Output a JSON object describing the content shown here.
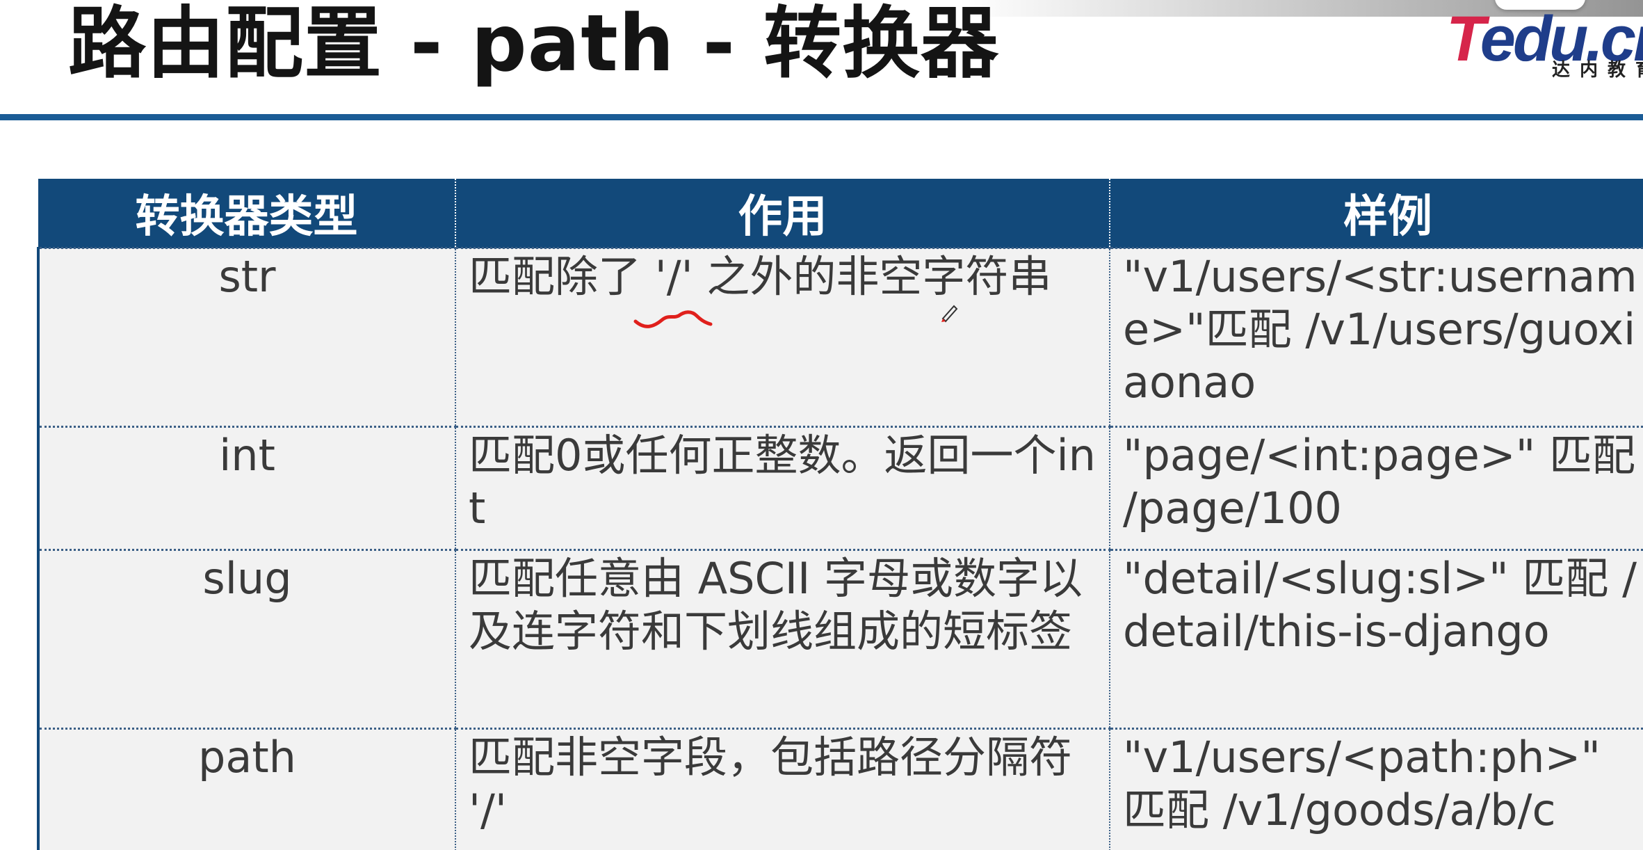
{
  "slide": {
    "title": "路由配置 - path - 转换器"
  },
  "logo": {
    "brand_first": "T",
    "brand_rest": "edu.cn",
    "subtitle": "达内教育"
  },
  "table": {
    "headers": {
      "type": "转换器类型",
      "purpose": "作用",
      "example": "样例"
    },
    "rows": [
      {
        "type": "str",
        "purpose": "匹配除了 '/' 之外的非空字符串",
        "example": "\"v1/users/<str:username>\"匹配 /v1/users/guoxiaonao"
      },
      {
        "type": "int",
        "purpose": "匹配0或任何正整数。返回一个int",
        "example": "\"page/<int:page>\" 匹配 /page/100"
      },
      {
        "type": "slug",
        "purpose": "匹配任意由 ASCII 字母或数字以及连字符和下划线组成的短标签",
        "example": "\"detail/<slug:sl>\" 匹配 /detail/this-is-django"
      },
      {
        "type": "path",
        "purpose": "匹配非空字段，包括路径分隔符 '/'",
        "example": "\"v1/users/<path:ph>\" 匹配 /v1/goods/a/b/c"
      }
    ]
  },
  "colors": {
    "header_bg": "#12497a",
    "rule": "#1b5c96",
    "cell_bg": "#f2f2f2",
    "logo_red": "#d6254a",
    "logo_blue": "#1f3d8a",
    "annotation": "#e0201c"
  }
}
